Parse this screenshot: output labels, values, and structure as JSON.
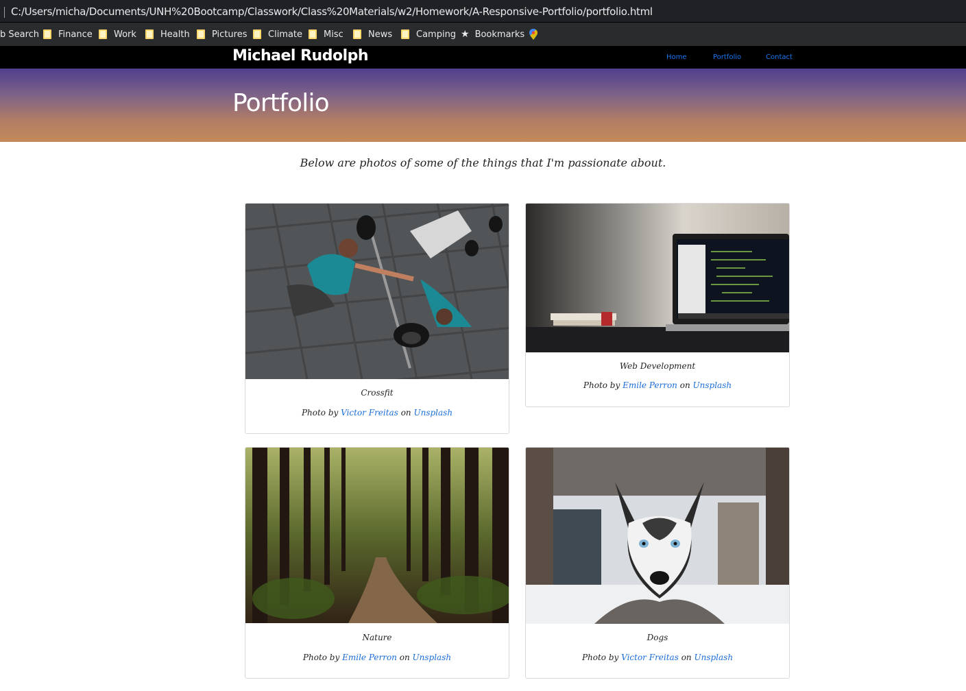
{
  "browser": {
    "url": "C:/Users/micha/Documents/UNH%20Bootcamp/Classwork/Class%20Materials/w2/Homework/A-Responsive-Portfolio/portfolio.html",
    "bookmarks": [
      "b Search",
      "Finance",
      "Work",
      "Health",
      "Pictures",
      "Climate",
      "Misc",
      "News",
      "Camping",
      "Bookmarks"
    ]
  },
  "site": {
    "brand": "Michael Rudolph",
    "nav": [
      "Home",
      "Portfolio",
      "Contact"
    ],
    "hero_title": "Portfolio",
    "intro": "Below are photos of some of the things that I'm passionate about."
  },
  "cards": [
    {
      "title": "Crossfit",
      "photo_by": "Photo by",
      "author": "Victor Freitas",
      "on": "on",
      "source": "Unsplash"
    },
    {
      "title": "Web Development",
      "photo_by": "Photo by",
      "author": "Emile Perron",
      "on": "on",
      "source": "Unsplash"
    },
    {
      "title": "Nature",
      "photo_by": "Photo by",
      "author": "Emile Perron",
      "on": "on",
      "source": "Unsplash"
    },
    {
      "title": "Dogs",
      "photo_by": "Photo by",
      "author": "Victor Freitas",
      "on": "on",
      "source": "Unsplash"
    }
  ],
  "colors": {
    "navbar": "#000000",
    "link": "#1877f2",
    "hero_top": "#4f3f8e",
    "hero_bottom": "#c58a5a"
  }
}
